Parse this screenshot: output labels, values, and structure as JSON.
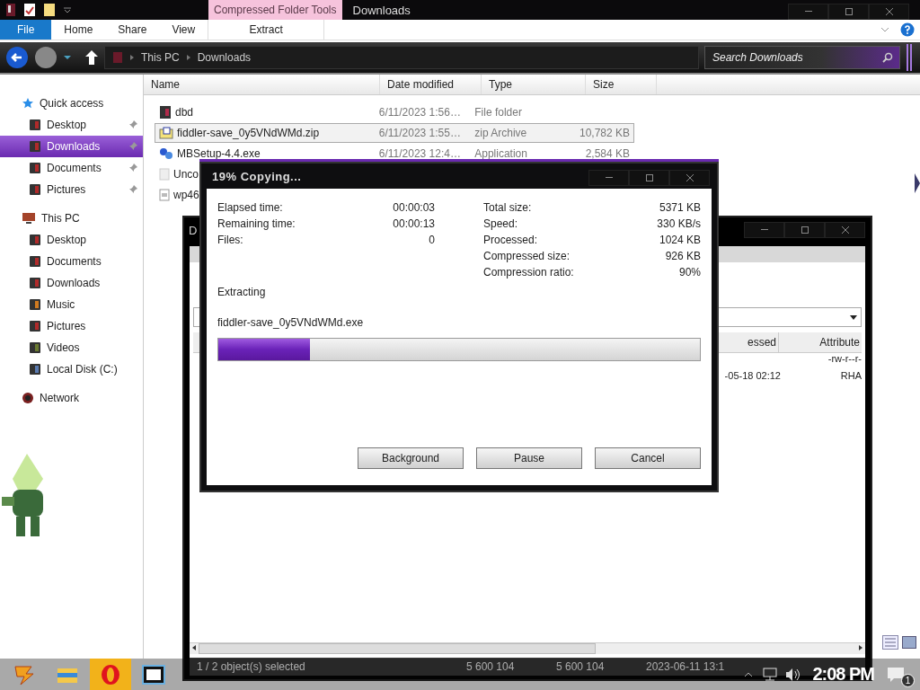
{
  "explorer": {
    "title": "Downloads",
    "contextual_tab": "Compressed Folder Tools",
    "ribbon_tabs": [
      {
        "label": "File",
        "kind": "file"
      },
      {
        "label": "Home",
        "kind": "tab"
      },
      {
        "label": "Share",
        "kind": "tab"
      },
      {
        "label": "View",
        "kind": "tab"
      },
      {
        "label": "Extract",
        "kind": "context"
      }
    ],
    "breadcrumb": [
      "This PC",
      "Downloads"
    ],
    "search": {
      "placeholder": "Search Downloads"
    },
    "nav": [
      {
        "label": "Quick access",
        "kind": "star",
        "children": [
          {
            "label": "Desktop",
            "kind": "desktop",
            "pinned": true,
            "selected": false
          },
          {
            "label": "Downloads",
            "kind": "downloads",
            "pinned": true,
            "selected": true
          },
          {
            "label": "Documents",
            "kind": "documents",
            "pinned": true,
            "selected": false
          },
          {
            "label": "Pictures",
            "kind": "pictures",
            "pinned": true,
            "selected": false
          }
        ]
      },
      {
        "label": "This PC",
        "kind": "pc",
        "children": [
          {
            "label": "Desktop",
            "kind": "desktop",
            "pinned": false,
            "selected": false
          },
          {
            "label": "Documents",
            "kind": "documents",
            "pinned": false,
            "selected": false
          },
          {
            "label": "Downloads",
            "kind": "downloads",
            "pinned": false,
            "selected": false
          },
          {
            "label": "Music",
            "kind": "music",
            "pinned": false,
            "selected": false
          },
          {
            "label": "Pictures",
            "kind": "pictures",
            "pinned": false,
            "selected": false
          },
          {
            "label": "Videos",
            "kind": "videos",
            "pinned": false,
            "selected": false
          },
          {
            "label": "Local Disk (C:)",
            "kind": "disk",
            "pinned": false,
            "selected": false
          }
        ]
      },
      {
        "label": "Network",
        "kind": "network"
      }
    ],
    "columns": [
      "Name",
      "Date modified",
      "Type",
      "Size"
    ],
    "rows": [
      {
        "kind": "folder",
        "name": "dbd",
        "date": "6/11/2023 1:56…",
        "type": "File folder",
        "size": "",
        "selected": false
      },
      {
        "kind": "zip",
        "name": "fiddler-save_0y5VNdWMd.zip",
        "date": "6/11/2023 1:55…",
        "type": "zip Archive",
        "size": "10,782 KB",
        "selected": true
      },
      {
        "kind": "exe",
        "name": "MBSetup-4.4.exe",
        "date": "6/11/2023 12:4…",
        "type": "Application",
        "size": "2,584 KB",
        "selected": false
      },
      {
        "kind": "blank",
        "name": "Unco",
        "date": "",
        "type": "",
        "size": "",
        "selected": false
      },
      {
        "kind": "doc",
        "name": "wp46",
        "date": "",
        "type": "",
        "size": "",
        "selected": false
      }
    ]
  },
  "archiver": {
    "title": "D",
    "columns": [
      "essed",
      "Attribute"
    ],
    "rows": [
      {
        "column_1": "",
        "column_2": "-rw-r--r-"
      },
      {
        "column_1": "-05-18 02:12",
        "column_2": "RHA"
      }
    ],
    "status": [
      "1 / 2 object(s) selected",
      "5 600 104",
      "5 600 104",
      "2023-06-11 13:1"
    ]
  },
  "dialog": {
    "title": "19% Copying...",
    "stats_left": [
      {
        "label": "Elapsed time:",
        "value": "00:00:03"
      },
      {
        "label": "Remaining time:",
        "value": "00:00:13"
      },
      {
        "label": "Files:",
        "value": "0"
      }
    ],
    "stats_right": [
      {
        "label": "Total size:",
        "value": "5371 KB"
      },
      {
        "label": "Speed:",
        "value": "330 KB/s"
      },
      {
        "label": "Processed:",
        "value": "1024 KB"
      },
      {
        "label": "Compressed size:",
        "value": "926 KB"
      },
      {
        "label": "Compression ratio:",
        "value": "90%"
      }
    ],
    "status": "Extracting",
    "file": "fiddler-save_0y5VNdWMd.exe",
    "progress": {
      "level": 0.19
    },
    "buttons": [
      "Background",
      "Pause",
      "Cancel"
    ]
  },
  "taskbar": {
    "apps": [
      {
        "kind": "start",
        "selected": false
      },
      {
        "kind": "explorer",
        "selected": false
      },
      {
        "kind": "opera",
        "selected": true
      },
      {
        "kind": "sevenzip",
        "selected": false
      }
    ],
    "clock": "2:08 PM",
    "notifications": "1"
  }
}
